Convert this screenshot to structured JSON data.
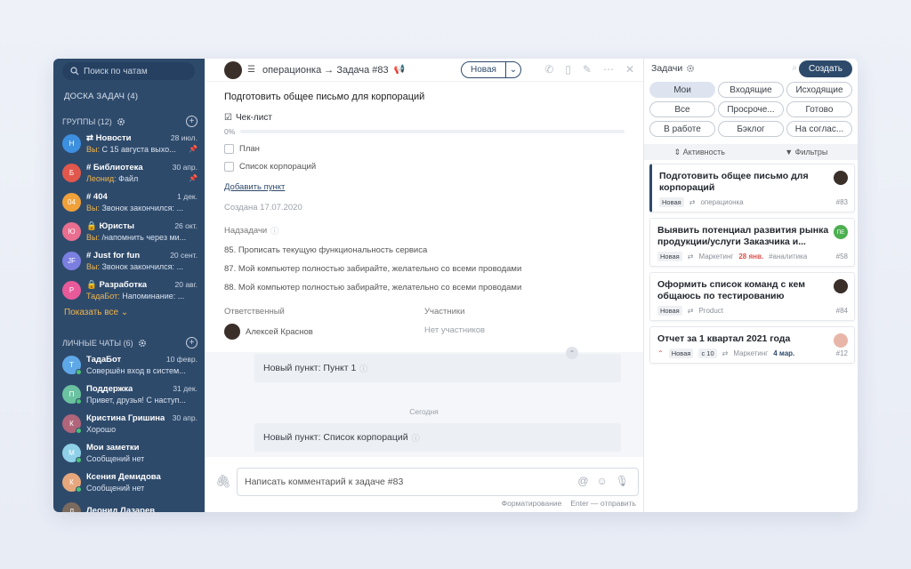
{
  "sidebar": {
    "search_placeholder": "Поиск по чатам",
    "board_link": "ДОСКА ЗАДАЧ (4)",
    "groups_header": "ГРУППЫ (12)",
    "groups": [
      {
        "initial": "Н",
        "color": "#3d8fe0",
        "name": "⇄ Новости",
        "date": "28 июл.",
        "preview_who": "Вы:",
        "preview": " С 15 августа выхо...",
        "pinned": "📌"
      },
      {
        "initial": "Б",
        "color": "#e2574c",
        "name": "# Библиотека",
        "date": "30 апр.",
        "preview_who": "Леонид:",
        "preview": " Файл",
        "pinned": "📌"
      },
      {
        "initial": "04",
        "color": "#f0a13a",
        "name": "# 404",
        "date": "1 дек.",
        "preview_who": "Вы:",
        "preview": " Звонок закончился: ...",
        "pinned": ""
      },
      {
        "initial": "Ю",
        "color": "#e96e8f",
        "name": "🔒 Юристы",
        "date": "26 окт.",
        "preview_who": "Вы:",
        "preview": " /напомнить через ми...",
        "pinned": ""
      },
      {
        "initial": "JF",
        "color": "#7b7fe0",
        "name": "# Just for fun",
        "date": "20 сент.",
        "preview_who": "Вы:",
        "preview": " Звонок закончился: ...",
        "pinned": ""
      },
      {
        "initial": "Р",
        "color": "#e85a9a",
        "name": "🔒 Разработка",
        "date": "20 авг.",
        "preview_who": "ТадаБот:",
        "preview": " Напоминание: ...",
        "pinned": ""
      }
    ],
    "show_all": "Показать все ⌄",
    "personal_header": "ЛИЧНЫЕ ЧАТЫ (6)",
    "personal": [
      {
        "initial": "Т",
        "color": "#5fa8e8",
        "name": "ТадаБот",
        "date": "10 февр.",
        "preview": "Совершён вход в систем..."
      },
      {
        "initial": "П",
        "color": "#6ac2a0",
        "name": "Поддержка",
        "date": "31 дек.",
        "preview": "Привет, друзья! С наступ..."
      },
      {
        "initial": "К",
        "color": "#b0657a",
        "name": "Кристина Гришина",
        "date": "30 апр.",
        "preview": "Хорошо"
      },
      {
        "initial": "М",
        "color": "#8fd0e8",
        "name": "Мои заметки",
        "date": "",
        "preview": "Сообщений нет"
      },
      {
        "initial": "К",
        "color": "#e6a77c",
        "name": "Ксения Демидова",
        "date": "",
        "preview": "Сообщений нет"
      },
      {
        "initial": "Л",
        "color": "#7b6a5e",
        "name": "Леонид Лазарев",
        "date": "",
        "preview": ""
      }
    ]
  },
  "main": {
    "breadcrumb": "операционка → Задача #83",
    "status": "Новая",
    "task_title": "Подготовить общее письмо для корпораций",
    "checklist_title": "Чек-лист",
    "checklist_pct": "0%",
    "checklist_items": [
      "План",
      "Список корпораций"
    ],
    "add_item": "Добавить пункт",
    "created": "Создана 17.07.2020",
    "subtasks_label": "Надзадачи",
    "subtasks": [
      "85. Прописать текущую функциональность сервиса",
      "87. Мой компьютер полностью забирайте, желательно со всеми проводами",
      "88. Мой компьютер полностью забирайте, желательно со всеми проводами"
    ],
    "assignee_label": "Ответственный",
    "assignee": "Алексей Краснов",
    "participants_label": "Участники",
    "participants": "Нет участников",
    "feed": {
      "msg1": "Новый пункт: Пункт 1",
      "day": "Сегодня",
      "msg2": "Новый пункт: Список корпораций"
    },
    "composer_placeholder": "Написать комментарий к задаче #83",
    "hint_format": "Форматирование",
    "hint_send": "Enter — отправить"
  },
  "right": {
    "title": "Задачи",
    "create": "Создать",
    "filters": [
      "Мои",
      "Входящие",
      "Исходящие",
      "Все",
      "Просроче...",
      "Готово",
      "В работе",
      "Бэклог",
      "На соглас..."
    ],
    "sort": "⇕ Активность",
    "filter_btn": "▼ Фильтры",
    "cards": [
      {
        "title": "Подготовить общее письмо для корпораций",
        "badge": "Новая",
        "project": "операционка",
        "extra": "",
        "tag": "",
        "num": "#83",
        "ava": "",
        "ava_color": "#3b2f2a"
      },
      {
        "title": "Выявить потенциал развития рынка продукции/услуги Заказчика и...",
        "badge": "Новая",
        "project": "Маркетинг",
        "extra": "28 янв.",
        "tag": "#аналитика",
        "num": "#58",
        "ava": "ПЕ",
        "ava_color": "#4caf50"
      },
      {
        "title": "Оформить список команд с кем общаюсь по тестированию",
        "badge": "Новая",
        "project": "Product",
        "extra": "",
        "tag": "",
        "num": "#84",
        "ava": "",
        "ava_color": "#3b2f2a"
      },
      {
        "title": "Отчет за 1 квартал 2021 года",
        "badge": "Новая",
        "project": "Маркетинг",
        "extra": "4 мар.",
        "tag": "с 10",
        "num": "#12",
        "ava": "",
        "ava_color": "#e8b6a8"
      }
    ]
  }
}
